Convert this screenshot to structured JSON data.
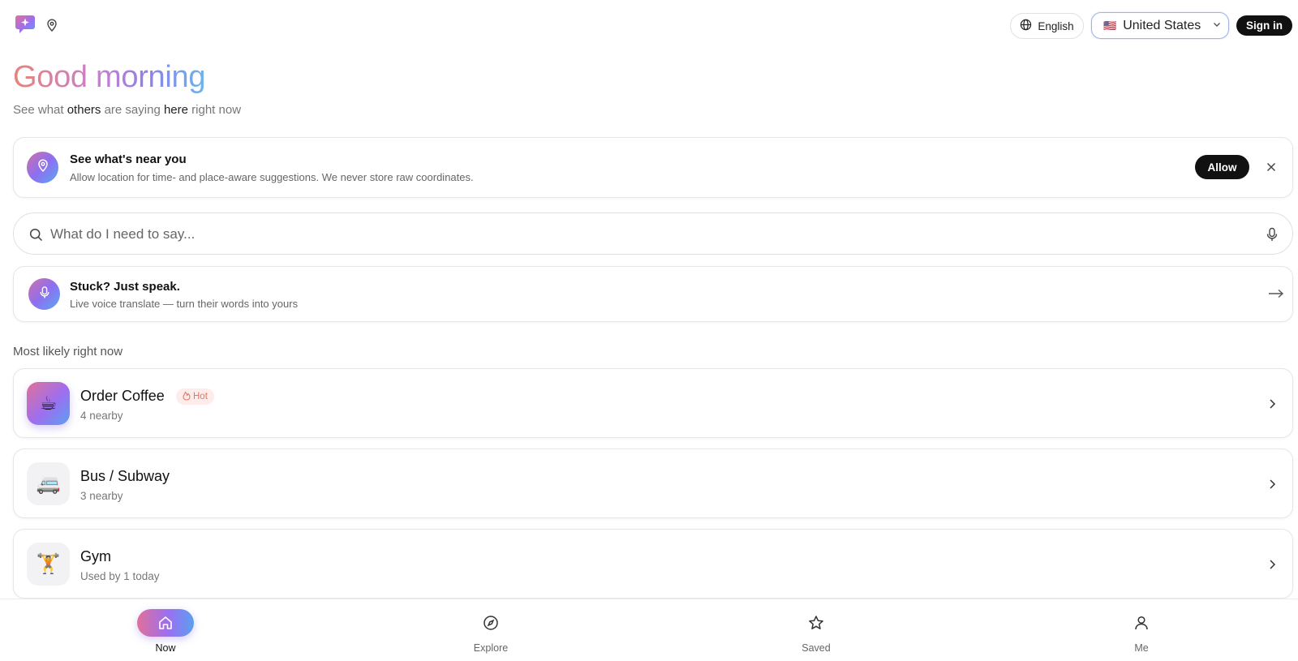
{
  "header": {
    "language_label": "English",
    "country_flag": "🇺🇸",
    "country_label": "United States",
    "signin_label": "Sign in"
  },
  "greeting": {
    "title": "Good morning",
    "subtitle_parts": [
      "See what ",
      "others",
      " are saying ",
      "here",
      " right now"
    ]
  },
  "location_prompt": {
    "title": "See what's near you",
    "description": "Allow location for time- and place-aware suggestions. We never store raw coordinates.",
    "allow_label": "Allow"
  },
  "search": {
    "placeholder": "What do I need to say..."
  },
  "voice_card": {
    "title": "Stuck? Just speak.",
    "description": "Live voice translate — turn their words into yours"
  },
  "section": {
    "label": "Most likely right now"
  },
  "suggestions": [
    {
      "emoji": "☕",
      "title": "Order Coffee",
      "subtitle": "4 nearby",
      "badge": "Hot"
    },
    {
      "emoji": "🚐",
      "title": "Bus / Subway",
      "subtitle": "3 nearby"
    },
    {
      "emoji": "🏋️",
      "title": "Gym",
      "subtitle": "Used by 1 today"
    }
  ],
  "nav": [
    {
      "label": "Now",
      "icon": "home-icon"
    },
    {
      "label": "Explore",
      "icon": "compass-icon"
    },
    {
      "label": "Saved",
      "icon": "star-icon"
    },
    {
      "label": "Me",
      "icon": "user-icon"
    }
  ],
  "colors": {
    "accent_pink": "#e0709a",
    "accent_purple": "#9c6ff0",
    "accent_blue": "#5aa0f0",
    "dark_button": "#111111",
    "hot_badge_bg": "#fdecea",
    "hot_badge_text": "#e0786a"
  }
}
